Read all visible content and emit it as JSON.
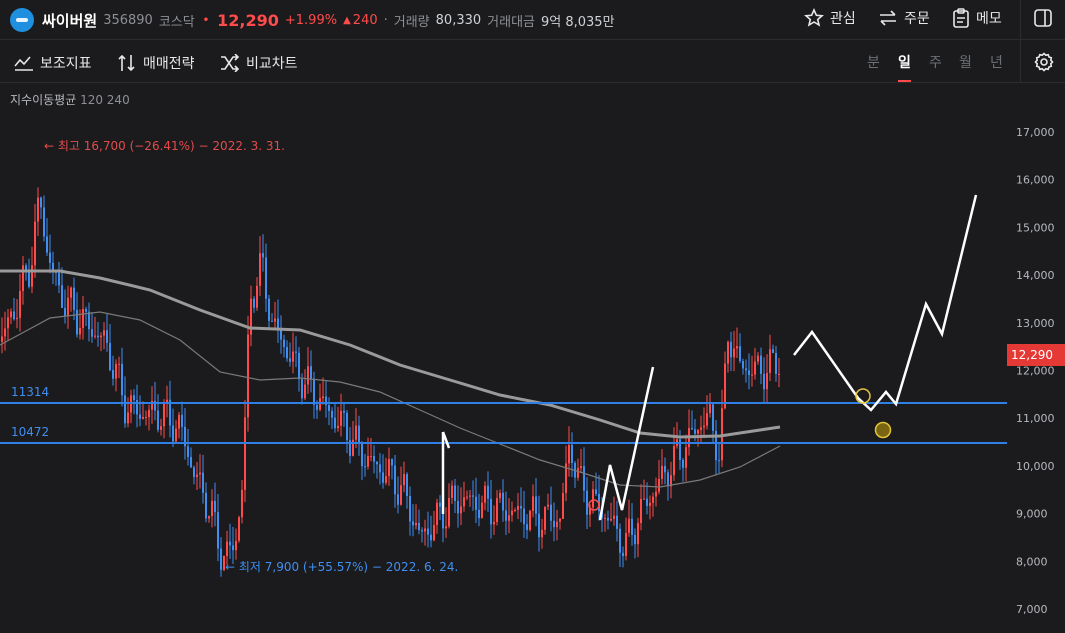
{
  "header": {
    "name": "싸이버원",
    "code": "356890",
    "market": "코스닥",
    "price": "12,290",
    "change_pct": "+1.99%",
    "change_arrow": "▲",
    "change_abs": "240",
    "volume_label": "거래량",
    "volume_value": "80,330",
    "amount_label": "거래대금",
    "amount_value": "9억 8,035만",
    "watch_label": "관심",
    "order_label": "주문",
    "memo_label": "메모"
  },
  "toolbar": {
    "indicator_label": "보조지표",
    "strategy_label": "매매전략",
    "compare_label": "비교차트",
    "periods": [
      "분",
      "일",
      "주",
      "월",
      "년"
    ],
    "active_period": "일"
  },
  "ma_legend": {
    "title": "지수이동평균",
    "periods": "120 240"
  },
  "chart": {
    "y_ticks": [
      "17,000",
      "16,000",
      "15,000",
      "14,000",
      "13,000",
      "12,000",
      "11,000",
      "10,000",
      "9,000",
      "8,000",
      "7,000"
    ],
    "current_price_tag": "12,290",
    "hline_values": [
      "11314",
      "10472"
    ],
    "high_annotation": "← 최고 16,700 (−26.41%) − 2022. 3. 31.",
    "low_annotation": "← 최저 7,900 (+55.57%) − 2022. 6. 24."
  },
  "colors": {
    "up": "#ff4b4b",
    "down": "#3f8ef0",
    "hline": "#2f7fe6",
    "ma120": "#9a9a9a",
    "ma240": "#7a7a7a"
  },
  "icons": [
    "star-icon",
    "swap-arrows-icon",
    "clipboard-icon",
    "panel-icon",
    "indicator-icon",
    "strategy-icon",
    "compare-icon",
    "gear-icon"
  ]
}
